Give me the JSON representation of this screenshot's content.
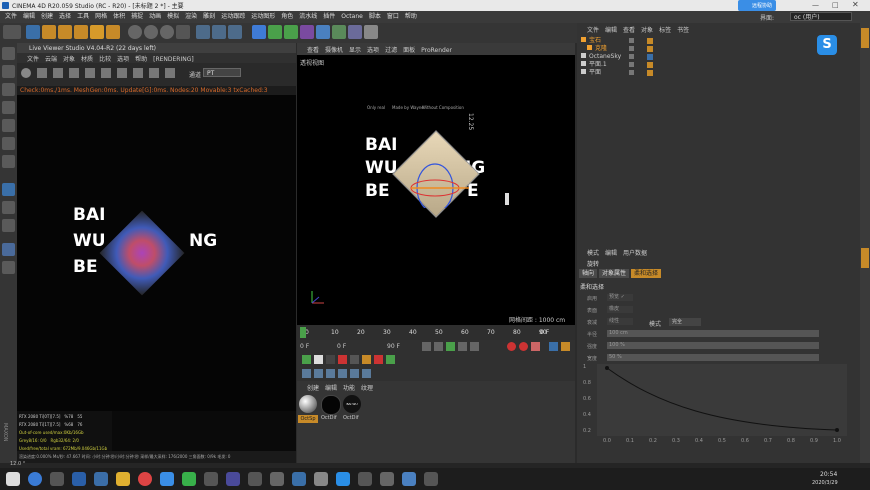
{
  "window": {
    "title": "CINEMA 4D R20.059 Studio (RC - R20) - [未标题 2 *] - 主要"
  },
  "menubar": {
    "items": [
      "文件",
      "编辑",
      "创建",
      "选择",
      "工具",
      "网格",
      "体积",
      "捕捉",
      "动画",
      "模拟",
      "渲染",
      "雕刻",
      "运动跟踪",
      "运动图形",
      "角色",
      "流水线",
      "插件",
      "Octane",
      "脚本",
      "窗口",
      "帮助"
    ],
    "layout_label": "界面:",
    "layout_value": "oc (用户)"
  },
  "live_viewer": {
    "title": "Live Viewer Studio V4.04-R2 (22 days left)",
    "menu": [
      "文件",
      "云端",
      "对象",
      "材质",
      "比较",
      "选项",
      "帮助",
      "[RENDERING]"
    ],
    "channel_label": "通道",
    "channel_value": "PT",
    "status_line": "Check:0ms./1ms. MeshGen:0ms. Update[G]:0ms. Nodes:20 Movable:3 txCached:3",
    "render_text": [
      "BAI",
      "WU",
      "NG",
      "BE"
    ],
    "stats": [
      {
        "label": "RTX 2080 Ti[0T][7.5]",
        "v1": "%78",
        "v2": "55"
      },
      {
        "label": "RTX 2080 Ti[1T][7.5]",
        "v1": "%68",
        "v2": "76"
      },
      {
        "label": "Out-of-core used/max:0Kb/16Gb",
        "v1": "",
        "v2": ""
      },
      {
        "label": "Grey8/16: 0/0",
        "v1": "Rgb32/64: 2/0",
        "v2": ""
      },
      {
        "label": "Used/free/total vram: 672Mb/9.046Gb/11Gb",
        "v1": "",
        "v2": ""
      }
    ],
    "footer": "渲染进度:0.000% Ms/秒: 47.667 时间: 小时:分钟:秒/小时:分钟:秒 采样/最大采样: 176/2000 三角面数: 0/9k 毛发: 0"
  },
  "viewport": {
    "menu": [
      "查看",
      "摄像机",
      "显示",
      "选项",
      "过滤",
      "面板",
      "ProRender"
    ],
    "label": "透视视图",
    "scene_text": [
      "BAI",
      "WU",
      "NG",
      "BE",
      "E"
    ],
    "small_text": [
      "Only real",
      "Made by Wayne",
      "Without Composition",
      "12.25"
    ],
    "grid_readout": "网格间距 : 1000 cm"
  },
  "timeline": {
    "ticks": [
      "0",
      "10",
      "20",
      "30",
      "40",
      "50",
      "60",
      "70",
      "80",
      "90"
    ],
    "frame_right": "0 F"
  },
  "playbar": {
    "start": "0 F",
    "min": "0 F",
    "max": "90 F",
    "end": "90 F"
  },
  "materials": {
    "menu": [
      "创建",
      "编辑",
      "功能",
      "纹理"
    ],
    "items": [
      "OctSp",
      "OctDif",
      "OctDif"
    ],
    "third_thumb_text": "BAI WU GUANG"
  },
  "objects": {
    "menu": [
      "文件",
      "编辑",
      "查看",
      "对象",
      "标签",
      "书签"
    ],
    "items": [
      {
        "name": "宝石",
        "color": "#f0a030"
      },
      {
        "name": "克隆",
        "color": "#f0a030"
      },
      {
        "name": "OctaneSky",
        "color": "#cccccc"
      },
      {
        "name": "平面.1",
        "color": "#cccccc"
      },
      {
        "name": "平面",
        "color": "#cccccc"
      }
    ]
  },
  "attributes": {
    "menu": [
      "模式",
      "编辑",
      "用户数据"
    ],
    "object_name": "旋转",
    "tabs": [
      "轴向",
      "对象属性",
      "柔和选择"
    ],
    "section": "柔和选择",
    "fields": [
      {
        "label": "启用",
        "value": "预览 ✓"
      },
      {
        "label": "表面",
        "value": "橡皮"
      },
      {
        "label": "衰减",
        "value": "线性"
      },
      {
        "label": "半径",
        "value": "100 cm"
      },
      {
        "label": "强度",
        "value": "100 %"
      },
      {
        "label": "宽度",
        "value": "50 %"
      }
    ],
    "mode_label": "模式",
    "mode_value": "完全",
    "graph_x_ticks": [
      "0.0",
      "0.1",
      "0.2",
      "0.3",
      "0.4",
      "0.5",
      "0.6",
      "0.7",
      "0.8",
      "0.9",
      "1.0"
    ],
    "graph_y_ticks": [
      "1",
      "0.8",
      "0.6",
      "0.4",
      "0.2"
    ]
  },
  "statusbar": {
    "text": "12.0 °"
  },
  "taskbar": {
    "time": "20:54",
    "date": "2020/3/29"
  },
  "remote_badge": {
    "label": "远程协助"
  }
}
